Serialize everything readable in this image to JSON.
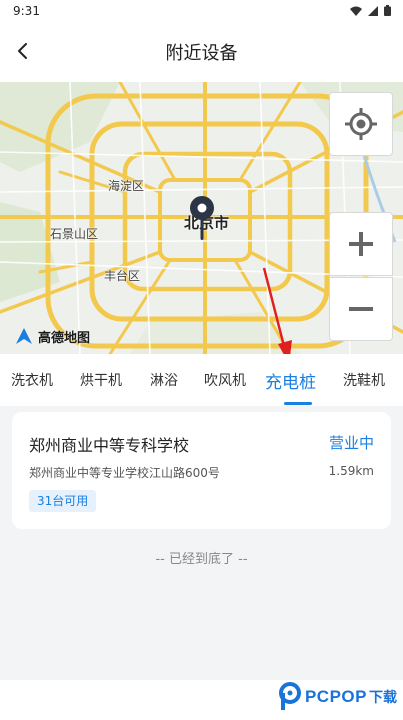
{
  "status_bar": {
    "time": "9:31"
  },
  "header": {
    "title": "附近设备"
  },
  "map": {
    "districts": [
      "海淀区",
      "石景山区",
      "丰台区",
      "北京市"
    ],
    "logo": "高德地图",
    "controls": [
      "locate",
      "zoom-in",
      "zoom-out"
    ]
  },
  "tabs": {
    "items": [
      "洗衣机",
      "烘干机",
      "淋浴",
      "吹风机",
      "充电桩",
      "洗鞋机"
    ],
    "active": "充电桩"
  },
  "results": [
    {
      "name": "郑州商业中等专科学校",
      "status": "营业中",
      "address": "郑州商业中等专业学校江山路600号",
      "distance": "1.59km",
      "availability": "31台可用"
    }
  ],
  "end_note": "-- 已经到底了 --",
  "watermark": {
    "brand": "PCPOP",
    "suffix": "下载"
  },
  "colors": {
    "accent": "#1a7fe0",
    "road": "#f5c842",
    "background": "#f3f4f6"
  }
}
